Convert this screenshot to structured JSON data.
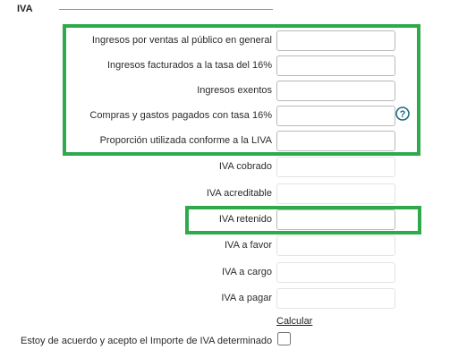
{
  "section": {
    "title": "IVA"
  },
  "fields": [
    {
      "label": "Ingresos por ventas al público en general",
      "value": ""
    },
    {
      "label": "Ingresos facturados a la tasa del 16%",
      "value": ""
    },
    {
      "label": "Ingresos exentos",
      "value": ""
    },
    {
      "label": "Compras y gastos pagados con tasa 16%",
      "value": ""
    },
    {
      "label": "Proporción utilizada conforme a la LIVA",
      "value": ""
    },
    {
      "label": "IVA cobrado",
      "value": ""
    },
    {
      "label": "IVA acreditable",
      "value": ""
    },
    {
      "label": "IVA retenido",
      "value": ""
    },
    {
      "label": "IVA a favor",
      "value": ""
    },
    {
      "label": "IVA a cargo",
      "value": ""
    },
    {
      "label": "IVA a pagar",
      "value": ""
    }
  ],
  "help_icon": {
    "name": "help-icon",
    "glyph": "?"
  },
  "calculate": {
    "label": "Calcular"
  },
  "agreement": {
    "label": "Estoy de acuerdo y acepto el Importe de IVA determinado",
    "checked": false
  },
  "colors": {
    "highlight": "#2eaa4c",
    "help_icon": "#1e6b7e"
  }
}
